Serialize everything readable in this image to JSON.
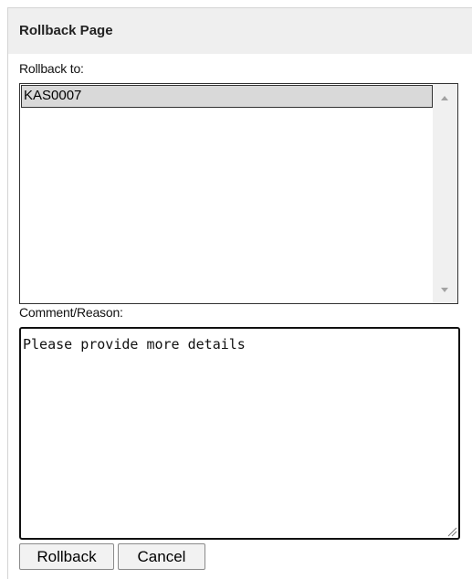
{
  "dialog": {
    "title": "Rollback Page"
  },
  "rollback": {
    "label": "Rollback to:",
    "options": [
      "KAS0007"
    ],
    "selected": "KAS0007"
  },
  "comment": {
    "label": "Comment/Reason:",
    "value": "Please provide more details"
  },
  "buttons": {
    "rollback": "Rollback",
    "cancel": "Cancel"
  },
  "icons": {
    "scroll_up": "chevron-up-icon",
    "scroll_down": "chevron-down-icon",
    "resize": "resize-grip-icon"
  },
  "colors": {
    "header_bg": "#efefef",
    "selected_option_bg": "#d9d9d9",
    "button_bg": "#f2f2f2"
  }
}
